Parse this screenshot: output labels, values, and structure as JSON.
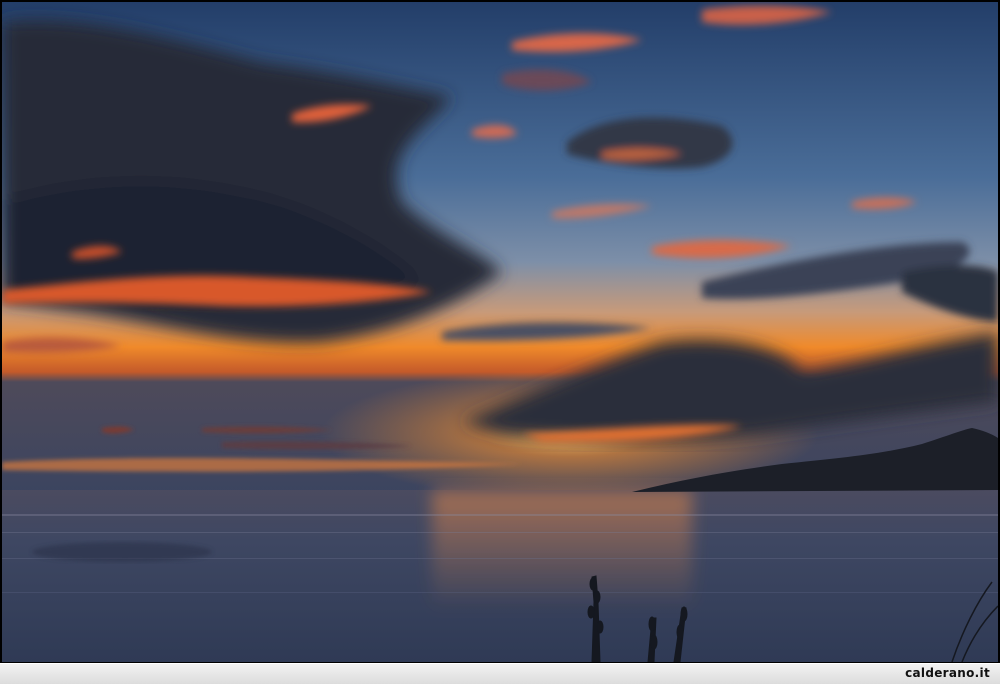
{
  "photo": {
    "subject": "sunset-over-sea",
    "colors": {
      "sky_top": "#2e4c78",
      "sky_mid": "#5a7aa2",
      "horizon_glow": "#f08a2a",
      "cloud_dark": "#2a2f3c",
      "cloud_lit": "#e0603a",
      "sea": "#3c4660",
      "land": "#1c1f28"
    }
  },
  "footer": {
    "watermark": "calderano.it"
  }
}
